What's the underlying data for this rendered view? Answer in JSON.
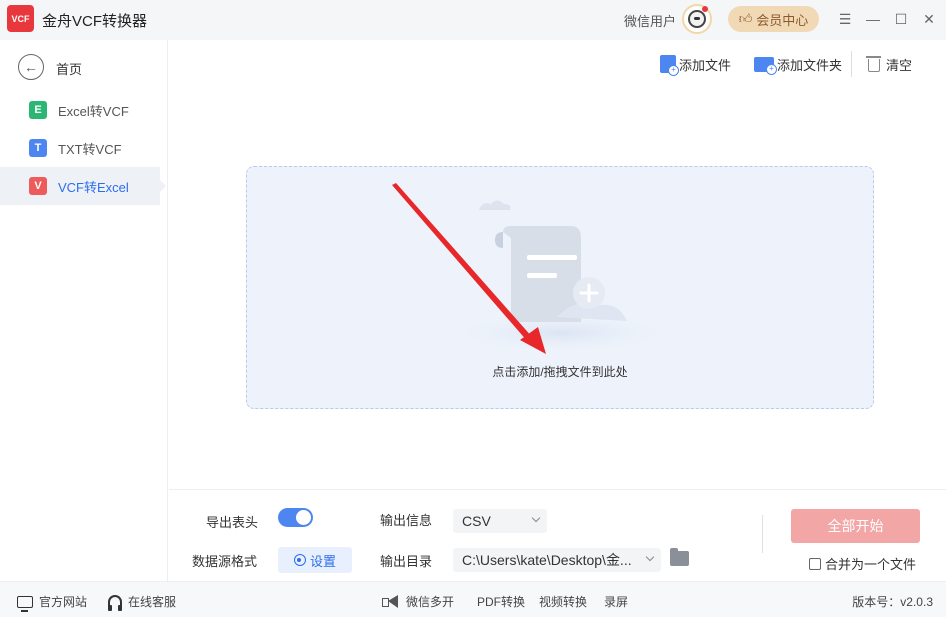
{
  "app": {
    "title": "金舟VCF转换器",
    "logo_text": "VCF"
  },
  "header": {
    "username": "微信用户",
    "vip_label": "会员中心"
  },
  "sidebar": {
    "home_label": "首页",
    "items": [
      {
        "badge": "E",
        "label": "Excel转VCF",
        "color": "#2bb673"
      },
      {
        "badge": "T",
        "label": "TXT转VCF",
        "color": "#4d86f0"
      },
      {
        "badge": "V",
        "label": "VCF转Excel",
        "color": "#ee5b5b",
        "active": true
      }
    ]
  },
  "toolbar": {
    "add_file": "添加文件",
    "add_folder": "添加文件夹",
    "clear": "清空"
  },
  "dropzone": {
    "hint": "点击添加/拖拽文件到此处"
  },
  "options": {
    "export_header_label": "导出表头",
    "export_header_on": true,
    "source_format_label": "数据源格式",
    "settings_label": "设置",
    "output_info_label": "输出信息",
    "output_format": "CSV",
    "output_dir_label": "输出目录",
    "output_dir": "C:\\Users\\kate\\Desktop\\金...",
    "start_label": "全部开始",
    "merge_label": "合并为一个文件",
    "merge_checked": false
  },
  "footer": {
    "website": "官方网站",
    "support": "在线客服",
    "wechat_multi": "微信多开",
    "pdf_convert": "PDF转换",
    "video_convert": "视频转换",
    "record": "录屏",
    "version": "版本号：v2.0.3"
  },
  "colors": {
    "accent": "#4d86f0",
    "brand_red": "#e8383d",
    "start_button": "#f2a6a6",
    "annotation_arrow": "#e8272a"
  }
}
